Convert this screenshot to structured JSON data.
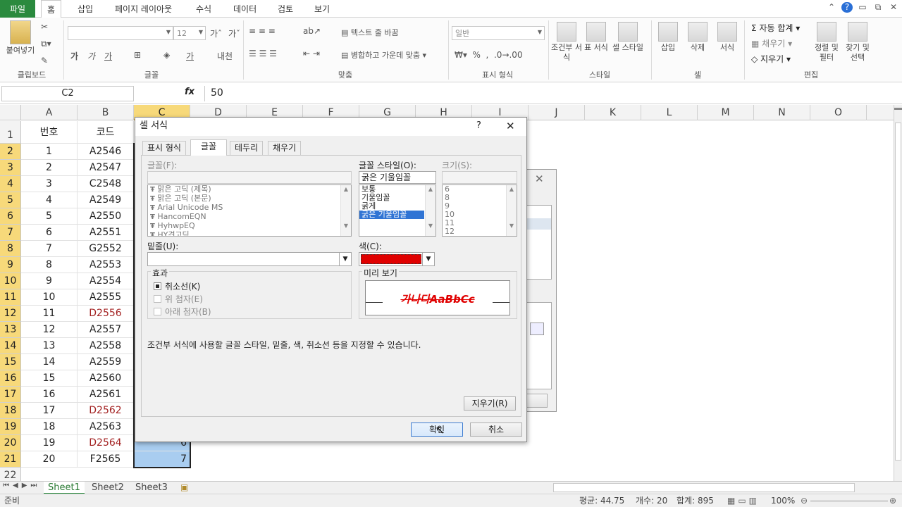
{
  "ribbon_tabs": {
    "file": "파일",
    "home": "홈",
    "insert": "삽입",
    "layout": "페이지 레이아웃",
    "formulas": "수식",
    "data": "데이터",
    "review": "검토",
    "view": "보기"
  },
  "ribbon": {
    "paste": "붙여넣기",
    "clipboard": "클립보드",
    "font_size": "12",
    "font_group": "글꼴",
    "wrap_text": "텍스트 줄 바꿈",
    "merge_center": "병합하고 가운데 맞춤",
    "alignment_group": "맞춤",
    "number_format": "일반",
    "number_group": "표시 형식",
    "cond_format": "조건부 서식",
    "table_format": "표 서식",
    "cell_style": "셀 스타일",
    "style_group": "스타일",
    "insert": "삽입",
    "delete": "삭제",
    "format": "서식",
    "cells_group": "셀",
    "autosum": "자동 합계",
    "fill": "채우기",
    "clear": "지우기",
    "sort_filter": "정렬 및 필터",
    "find_select": "찾기 및 선택",
    "editing_group": "편집"
  },
  "formula_bar": {
    "name_box": "C2",
    "fx": "fx",
    "value": "50"
  },
  "columns": [
    "A",
    "B",
    "C",
    "D",
    "E",
    "F",
    "G",
    "H",
    "I",
    "J",
    "K",
    "L",
    "M",
    "N",
    "O"
  ],
  "header_row": {
    "a": "번호",
    "b": "코드"
  },
  "rows": [
    {
      "n": "2",
      "a": "1",
      "b": "A2546",
      "red": false
    },
    {
      "n": "3",
      "a": "2",
      "b": "A2547",
      "red": false
    },
    {
      "n": "4",
      "a": "3",
      "b": "C2548",
      "red": false
    },
    {
      "n": "5",
      "a": "4",
      "b": "A2549",
      "red": false
    },
    {
      "n": "6",
      "a": "5",
      "b": "A2550",
      "red": false
    },
    {
      "n": "7",
      "a": "6",
      "b": "A2551",
      "red": false
    },
    {
      "n": "8",
      "a": "7",
      "b": "G2552",
      "red": false
    },
    {
      "n": "9",
      "a": "8",
      "b": "A2553",
      "red": false
    },
    {
      "n": "10",
      "a": "9",
      "b": "A2554",
      "red": false
    },
    {
      "n": "11",
      "a": "10",
      "b": "A2555",
      "red": false
    },
    {
      "n": "12",
      "a": "11",
      "b": "D2556",
      "red": true
    },
    {
      "n": "13",
      "a": "12",
      "b": "A2557",
      "red": false
    },
    {
      "n": "14",
      "a": "13",
      "b": "A2558",
      "red": false
    },
    {
      "n": "15",
      "a": "14",
      "b": "A2559",
      "red": false
    },
    {
      "n": "16",
      "a": "15",
      "b": "A2560",
      "red": false
    },
    {
      "n": "17",
      "a": "16",
      "b": "A2561",
      "red": false
    },
    {
      "n": "18",
      "a": "17",
      "b": "D2562",
      "red": true
    },
    {
      "n": "19",
      "a": "18",
      "b": "A2563",
      "red": false
    },
    {
      "n": "20",
      "a": "19",
      "b": "D2564",
      "red": true
    },
    {
      "n": "21",
      "a": "20",
      "b": "F2565",
      "red": false
    }
  ],
  "row_labels": {
    "first": "1",
    "last": "22"
  },
  "c_visible": {
    "r20": "6",
    "r21": "7"
  },
  "dialog": {
    "title": "셀 서식",
    "help": "?",
    "close": "✕",
    "tabs": [
      "표시 형식",
      "글꼴",
      "테두리",
      "채우기"
    ],
    "font_label": "글꼴(F):",
    "font_list": [
      "맑은 고딕 (제목)",
      "맑은 고딕 (본문)",
      "Arial Unicode MS",
      "HancomEQN",
      "HyhwpEQ",
      "HY견고딕"
    ],
    "style_label": "글꼴 스타일(O):",
    "style_value": "굵은 기울임꼴",
    "style_list": [
      "보통",
      "기울임꼴",
      "굵게",
      "굵은 기울임꼴"
    ],
    "size_label": "크기(S):",
    "size_list": [
      "6",
      "8",
      "9",
      "10",
      "11",
      "12"
    ],
    "underline_label": "밑줄(U):",
    "color_label": "색(C):",
    "color_value": "#e00000",
    "effects_label": "효과",
    "strike": "취소선(K)",
    "superscript": "위 첨자(E)",
    "subscript": "아래 첨자(B)",
    "preview_label": "미리 보기",
    "preview_text": "가나다AaBbCc",
    "info": "조건부 서식에 사용할 글꼴 스타일, 밑줄, 색, 취소선 등을 지정할 수 있습니다.",
    "clear_button": "지우기(R)",
    "ok": "확인",
    "cancel": "취소"
  },
  "sheets": [
    "Sheet1",
    "Sheet2",
    "Sheet3"
  ],
  "status": {
    "ready": "준비",
    "average": "평균: 44.75",
    "count": "개수: 20",
    "sum": "합계: 895",
    "zoom": "100%"
  }
}
